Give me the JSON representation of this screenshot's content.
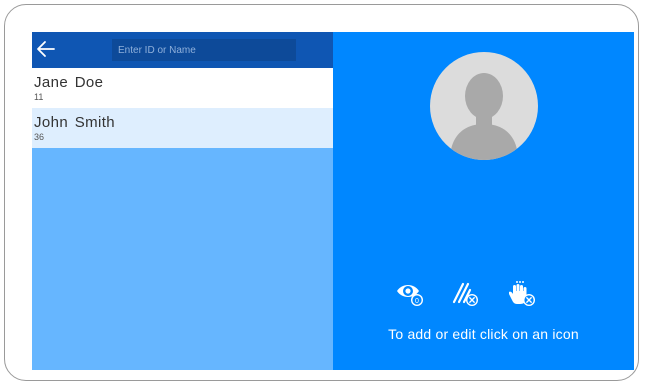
{
  "search": {
    "placeholder": "Enter ID or Name"
  },
  "icons": {
    "back": "arrow-left-icon",
    "avatar": "user-silhouette-icon",
    "eye": "eye-icon",
    "card": "card-swipe-icon",
    "hand": "hand-touch-icon"
  },
  "eye_badge": "0",
  "users": [
    {
      "name": "Jane  Doe",
      "id": "11"
    },
    {
      "name": "John  Smith",
      "id": "36"
    }
  ],
  "hint": "To add or edit click on an icon",
  "colors": {
    "topbar": "#0f56b3",
    "list_background": "#66b6ff",
    "panel_blue": "#0087ff",
    "selected_row": "#deeefe"
  }
}
